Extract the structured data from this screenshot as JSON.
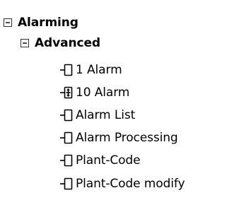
{
  "tree": {
    "root": {
      "label": "Alarming",
      "state": "expanded",
      "expander_icon": "collapse-box-icon"
    },
    "advanced": {
      "label": "Advanced",
      "state": "expanded",
      "expander_icon": "collapse-box-icon"
    },
    "items": [
      {
        "label": "1 Alarm",
        "icon": "tree-leaf-connector-icon"
      },
      {
        "label": "10 Alarm",
        "icon": "tree-expand-plus-icon"
      },
      {
        "label": "Alarm List",
        "icon": "tree-leaf-connector-icon"
      },
      {
        "label": "Alarm Processing",
        "icon": "tree-leaf-connector-icon"
      },
      {
        "label": "Plant-Code",
        "icon": "tree-leaf-connector-icon"
      },
      {
        "label": "Plant-Code modify",
        "icon": "tree-leaf-connector-icon"
      }
    ]
  }
}
